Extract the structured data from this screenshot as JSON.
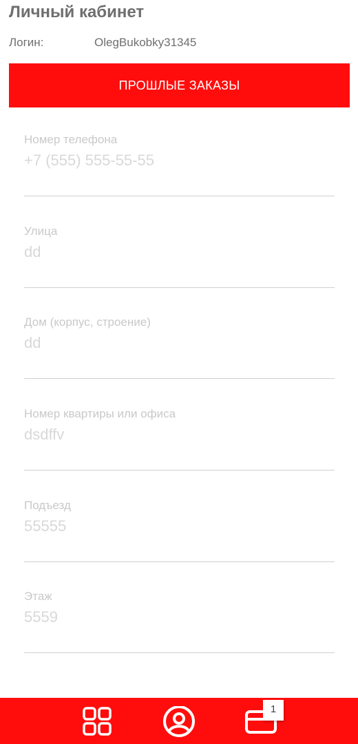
{
  "header": {
    "title": "Личный кабинет",
    "login_label": "Логин:",
    "login_value": "OlegBukobky31345"
  },
  "orders_button": {
    "label": "ПРОШЛЫЕ ЗАКАЗЫ"
  },
  "fields": [
    {
      "label": "Номер телефона",
      "value": "+7 (555) 555-55-55"
    },
    {
      "label": "Улица",
      "value": "dd"
    },
    {
      "label": "Дом (корпус, строение)",
      "value": "dd"
    },
    {
      "label": "Номер квартиры или офиса",
      "value": "dsdffv"
    },
    {
      "label": "Подъезд",
      "value": "55555"
    },
    {
      "label": "Этаж",
      "value": "5559"
    }
  ],
  "bottom_nav": {
    "items": [
      {
        "icon": "grid-icon"
      },
      {
        "icon": "profile-icon"
      },
      {
        "icon": "cart-icon"
      }
    ],
    "cart_badge": "1"
  },
  "colors": {
    "accent": "#ff0d0d",
    "title_text": "#6f6f6f",
    "field_label": "#c9c9c9",
    "field_value": "#d8d8d8",
    "divider": "#cfcfcf"
  }
}
